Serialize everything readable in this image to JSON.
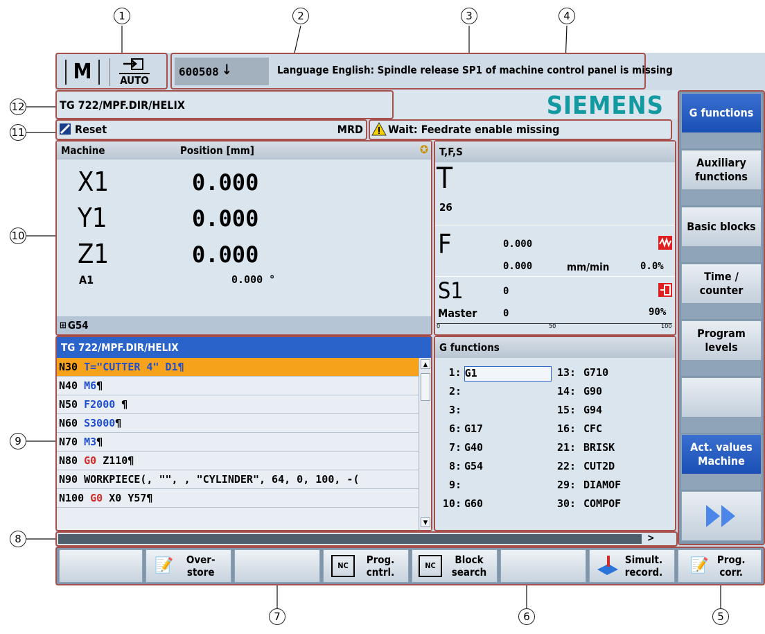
{
  "callouts": [
    "1",
    "2",
    "3",
    "4",
    "5",
    "6",
    "7",
    "8",
    "9",
    "10",
    "11",
    "12"
  ],
  "header": {
    "mode_label": "AUTO",
    "alarm_number": "600508",
    "alarm_text": "Language English: Spindle release SP1 of machine control panel is missing",
    "program_path": "TG 722/MPF.DIR/HELIX",
    "brand": "SIEMENS",
    "channel_status": "Reset",
    "mrd": "MRD",
    "wait_message": "Wait: Feedrate enable missing"
  },
  "positions": {
    "col_machine": "Machine",
    "col_position": "Position [mm]",
    "axes": [
      {
        "name": "X1",
        "value": "0.000"
      },
      {
        "name": "Y1",
        "value": "0.000"
      },
      {
        "name": "Z1",
        "value": "0.000"
      }
    ],
    "aux_axis": {
      "name": "A1",
      "value": "0.000 °"
    },
    "frame": "G54"
  },
  "tfs": {
    "title": "T,F,S",
    "tool_label": "T",
    "tool_number": "26",
    "feed_label": "F",
    "feed_value": "0.000",
    "feed_value2": "0.000",
    "feed_unit": "mm/min",
    "feed_override": "0.0%",
    "spindle_label": "S1",
    "spindle_value": "0",
    "spindle_master_label": "Master",
    "spindle_master_value": "0",
    "spindle_override": "90%",
    "scale": [
      "0",
      "50",
      "100"
    ]
  },
  "program": {
    "title": "TG 722/MPF.DIR/HELIX",
    "lines": [
      {
        "n": "N30",
        "rest": "T=\"CUTTER 4\" D1¶"
      },
      {
        "n": "N40",
        "kw": "M6",
        "rest": "¶"
      },
      {
        "n": "N50",
        "kw": "F2000",
        "rest": " ¶"
      },
      {
        "n": "N60",
        "kw": "S3000",
        "rest": "¶"
      },
      {
        "n": "N70",
        "kw": "M3",
        "rest": "¶"
      },
      {
        "n": "N80",
        "kwr": "G0",
        "rest": " Z110¶"
      },
      {
        "n": "N90",
        "rest": "WORKPIECE(, \"\", , \"CYLINDER\", 64, 0, 100, -("
      },
      {
        "n": "N100",
        "kwr": "G0",
        "rest": " X0 Y57¶"
      }
    ]
  },
  "gfunctions": {
    "title": "G functions",
    "left": [
      {
        "idx": "1:",
        "val": "G1"
      },
      {
        "idx": "2:",
        "val": ""
      },
      {
        "idx": "3:",
        "val": ""
      },
      {
        "idx": "6:",
        "val": "G17"
      },
      {
        "idx": "7:",
        "val": "G40"
      },
      {
        "idx": "8:",
        "val": "G54"
      },
      {
        "idx": "9:",
        "val": ""
      },
      {
        "idx": "10:",
        "val": "G60"
      }
    ],
    "right": [
      {
        "idx": "13:",
        "val": "G710"
      },
      {
        "idx": "14:",
        "val": "G90"
      },
      {
        "idx": "15:",
        "val": "G94"
      },
      {
        "idx": "16:",
        "val": "CFC"
      },
      {
        "idx": "21:",
        "val": "BRISK"
      },
      {
        "idx": "22:",
        "val": "CUT2D"
      },
      {
        "idx": "29:",
        "val": "DIAMOF"
      },
      {
        "idx": "30:",
        "val": "COMPOF"
      }
    ]
  },
  "vsoftkeys": [
    {
      "label": "G functions",
      "active": true
    },
    {
      "label": "Auxiliary functions"
    },
    {
      "label": "Basic blocks"
    },
    {
      "label": "Time / counter"
    },
    {
      "label": "Program levels"
    },
    {
      "label": ""
    },
    {
      "label": "Act. values Machine",
      "active": true
    }
  ],
  "hsoftkeys": [
    {
      "label": ""
    },
    {
      "label": "Over- store"
    },
    {
      "label": ""
    },
    {
      "label": "Prog. cntrl."
    },
    {
      "label": "Block search"
    },
    {
      "label": ""
    },
    {
      "label": "Simult. record."
    },
    {
      "label": "Prog. corr."
    }
  ],
  "status_bar": ">",
  "colors": {
    "accent_blue": "#1a4fb5",
    "highlight_orange": "#f7a21b",
    "frame_red": "#a7504b"
  }
}
